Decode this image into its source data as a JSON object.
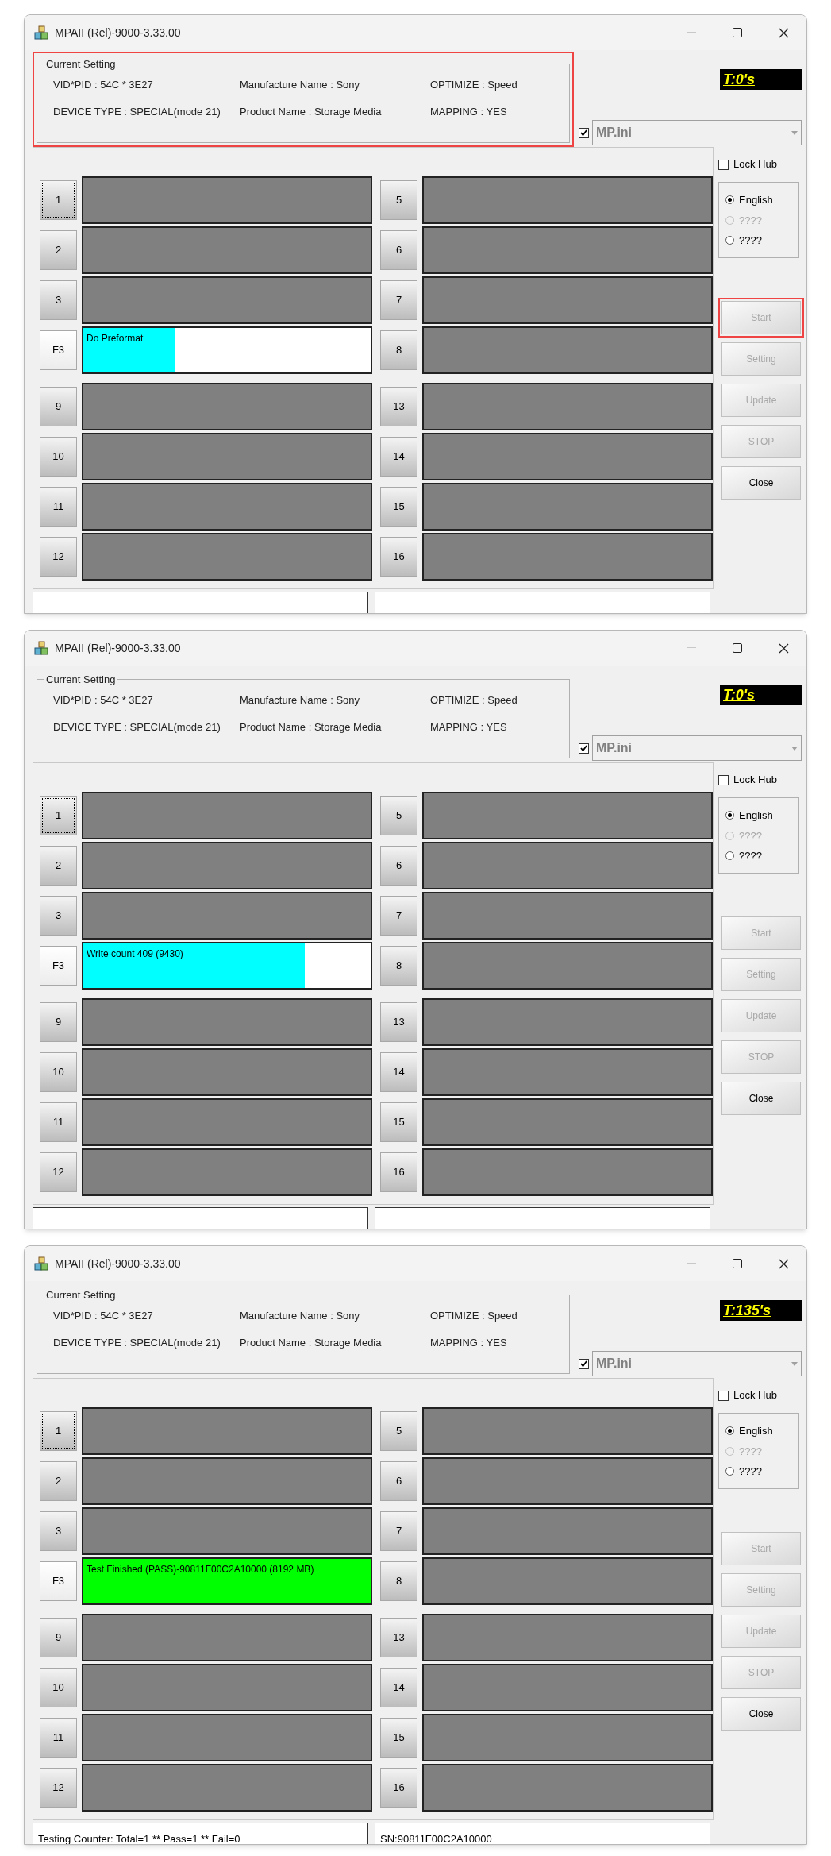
{
  "windows": [
    {
      "title": "MPAII (Rel)-9000-3.33.00",
      "timer": "T:0's",
      "current_setting": {
        "legend": "Current Setting",
        "highlighted": true,
        "fields": [
          "VID*PID :  54C * 3E27",
          "Manufacture Name : Sony",
          "OPTIMIZE : Speed",
          "DEVICE TYPE : SPECIAL(mode 21)",
          "Product Name : Storage Media",
          "MAPPING : YES"
        ]
      },
      "ini": {
        "checked": true,
        "value": "MP.ini"
      },
      "lock_hub": {
        "label": "Lock Hub",
        "checked": false
      },
      "languages": [
        {
          "label": "English",
          "selected": true,
          "disabled": false
        },
        {
          "label": "????",
          "selected": false,
          "disabled": true
        },
        {
          "label": "????",
          "selected": false,
          "disabled": false
        }
      ],
      "buttons": [
        {
          "label": "Start",
          "disabled": true,
          "highlighted": true
        },
        {
          "label": "Setting",
          "disabled": true,
          "highlighted": false
        },
        {
          "label": "Update",
          "disabled": true,
          "highlighted": false
        },
        {
          "label": "STOP",
          "disabled": true,
          "highlighted": false
        },
        {
          "label": "Close",
          "disabled": false,
          "highlighted": false
        }
      ],
      "left_slots": [
        {
          "label": "1",
          "focused": true,
          "kind": "idle"
        },
        {
          "label": "2",
          "focused": false,
          "kind": "idle"
        },
        {
          "label": "3",
          "focused": false,
          "kind": "idle"
        },
        {
          "label": "F3",
          "focused": false,
          "kind": "running",
          "status": "Do Preformat",
          "level": 0.32
        },
        {
          "label": "9",
          "focused": false,
          "kind": "idle"
        },
        {
          "label": "10",
          "focused": false,
          "kind": "idle"
        },
        {
          "label": "11",
          "focused": false,
          "kind": "idle"
        },
        {
          "label": "12",
          "focused": false,
          "kind": "idle"
        }
      ],
      "right_slots": [
        {
          "label": "5",
          "focused": false,
          "kind": "idle"
        },
        {
          "label": "6",
          "focused": false,
          "kind": "idle"
        },
        {
          "label": "7",
          "focused": false,
          "kind": "idle"
        },
        {
          "label": "8",
          "focused": false,
          "kind": "idle"
        },
        {
          "label": "13",
          "focused": false,
          "kind": "idle"
        },
        {
          "label": "14",
          "focused": false,
          "kind": "idle"
        },
        {
          "label": "15",
          "focused": false,
          "kind": "idle"
        },
        {
          "label": "16",
          "focused": false,
          "kind": "idle"
        }
      ]
    },
    {
      "title": "MPAII (Rel)-9000-3.33.00",
      "timer": "T:0's",
      "current_setting": {
        "legend": "Current Setting",
        "highlighted": false,
        "fields": [
          "VID*PID :  54C * 3E27",
          "Manufacture Name : Sony",
          "OPTIMIZE : Speed",
          "DEVICE TYPE : SPECIAL(mode 21)",
          "Product Name : Storage Media",
          "MAPPING : YES"
        ]
      },
      "ini": {
        "checked": true,
        "value": "MP.ini"
      },
      "lock_hub": {
        "label": "Lock Hub",
        "checked": false
      },
      "languages": [
        {
          "label": "English",
          "selected": true,
          "disabled": false
        },
        {
          "label": "????",
          "selected": false,
          "disabled": true
        },
        {
          "label": "????",
          "selected": false,
          "disabled": false
        }
      ],
      "buttons": [
        {
          "label": "Start",
          "disabled": true,
          "highlighted": false
        },
        {
          "label": "Setting",
          "disabled": true,
          "highlighted": false
        },
        {
          "label": "Update",
          "disabled": true,
          "highlighted": false
        },
        {
          "label": "STOP",
          "disabled": true,
          "highlighted": false
        },
        {
          "label": "Close",
          "disabled": false,
          "highlighted": false
        }
      ],
      "left_slots": [
        {
          "label": "1",
          "focused": true,
          "kind": "idle"
        },
        {
          "label": "2",
          "focused": false,
          "kind": "idle"
        },
        {
          "label": "3",
          "focused": false,
          "kind": "idle"
        },
        {
          "label": "F3",
          "focused": false,
          "kind": "running",
          "status": "Write count 409 (9430)",
          "level": 0.77
        },
        {
          "label": "9",
          "focused": false,
          "kind": "idle"
        },
        {
          "label": "10",
          "focused": false,
          "kind": "idle"
        },
        {
          "label": "11",
          "focused": false,
          "kind": "idle"
        },
        {
          "label": "12",
          "focused": false,
          "kind": "idle"
        }
      ],
      "right_slots": [
        {
          "label": "5",
          "focused": false,
          "kind": "idle"
        },
        {
          "label": "6",
          "focused": false,
          "kind": "idle"
        },
        {
          "label": "7",
          "focused": false,
          "kind": "idle"
        },
        {
          "label": "8",
          "focused": false,
          "kind": "idle"
        },
        {
          "label": "13",
          "focused": false,
          "kind": "idle"
        },
        {
          "label": "14",
          "focused": false,
          "kind": "idle"
        },
        {
          "label": "15",
          "focused": false,
          "kind": "idle"
        },
        {
          "label": "16",
          "focused": false,
          "kind": "idle"
        }
      ]
    },
    {
      "title": "MPAII (Rel)-9000-3.33.00",
      "timer": "T:135's",
      "current_setting": {
        "legend": "Current Setting",
        "highlighted": false,
        "fields": [
          "VID*PID :  54C * 3E27",
          "Manufacture Name : Sony",
          "OPTIMIZE : Speed",
          "DEVICE TYPE : SPECIAL(mode 21)",
          "Product Name : Storage Media",
          "MAPPING : YES"
        ]
      },
      "ini": {
        "checked": true,
        "value": "MP.ini"
      },
      "lock_hub": {
        "label": "Lock Hub",
        "checked": false
      },
      "languages": [
        {
          "label": "English",
          "selected": true,
          "disabled": false
        },
        {
          "label": "????",
          "selected": false,
          "disabled": true
        },
        {
          "label": "????",
          "selected": false,
          "disabled": false
        }
      ],
      "buttons": [
        {
          "label": "Start",
          "disabled": true,
          "highlighted": false
        },
        {
          "label": "Setting",
          "disabled": true,
          "highlighted": false
        },
        {
          "label": "Update",
          "disabled": true,
          "highlighted": false
        },
        {
          "label": "STOP",
          "disabled": true,
          "highlighted": false
        },
        {
          "label": "Close",
          "disabled": false,
          "highlighted": false
        }
      ],
      "left_slots": [
        {
          "label": "1",
          "focused": true,
          "kind": "idle"
        },
        {
          "label": "2",
          "focused": false,
          "kind": "idle"
        },
        {
          "label": "3",
          "focused": false,
          "kind": "idle"
        },
        {
          "label": "F3",
          "focused": false,
          "kind": "pass",
          "status": "Test Finished (PASS)-90811F00C2A10000 (8192 MB)"
        },
        {
          "label": "9",
          "focused": false,
          "kind": "idle"
        },
        {
          "label": "10",
          "focused": false,
          "kind": "idle"
        },
        {
          "label": "11",
          "focused": false,
          "kind": "idle"
        },
        {
          "label": "12",
          "focused": false,
          "kind": "idle"
        }
      ],
      "right_slots": [
        {
          "label": "5",
          "focused": false,
          "kind": "idle"
        },
        {
          "label": "6",
          "focused": false,
          "kind": "idle"
        },
        {
          "label": "7",
          "focused": false,
          "kind": "idle"
        },
        {
          "label": "8",
          "focused": false,
          "kind": "idle"
        },
        {
          "label": "13",
          "focused": false,
          "kind": "idle"
        },
        {
          "label": "14",
          "focused": false,
          "kind": "idle"
        },
        {
          "label": "15",
          "focused": false,
          "kind": "idle"
        },
        {
          "label": "16",
          "focused": false,
          "kind": "idle"
        }
      ],
      "footer": [
        "Testing Counter: Total=1 ** Pass=1 ** Fail=0",
        "SN:90811F00C2A10000"
      ]
    }
  ]
}
